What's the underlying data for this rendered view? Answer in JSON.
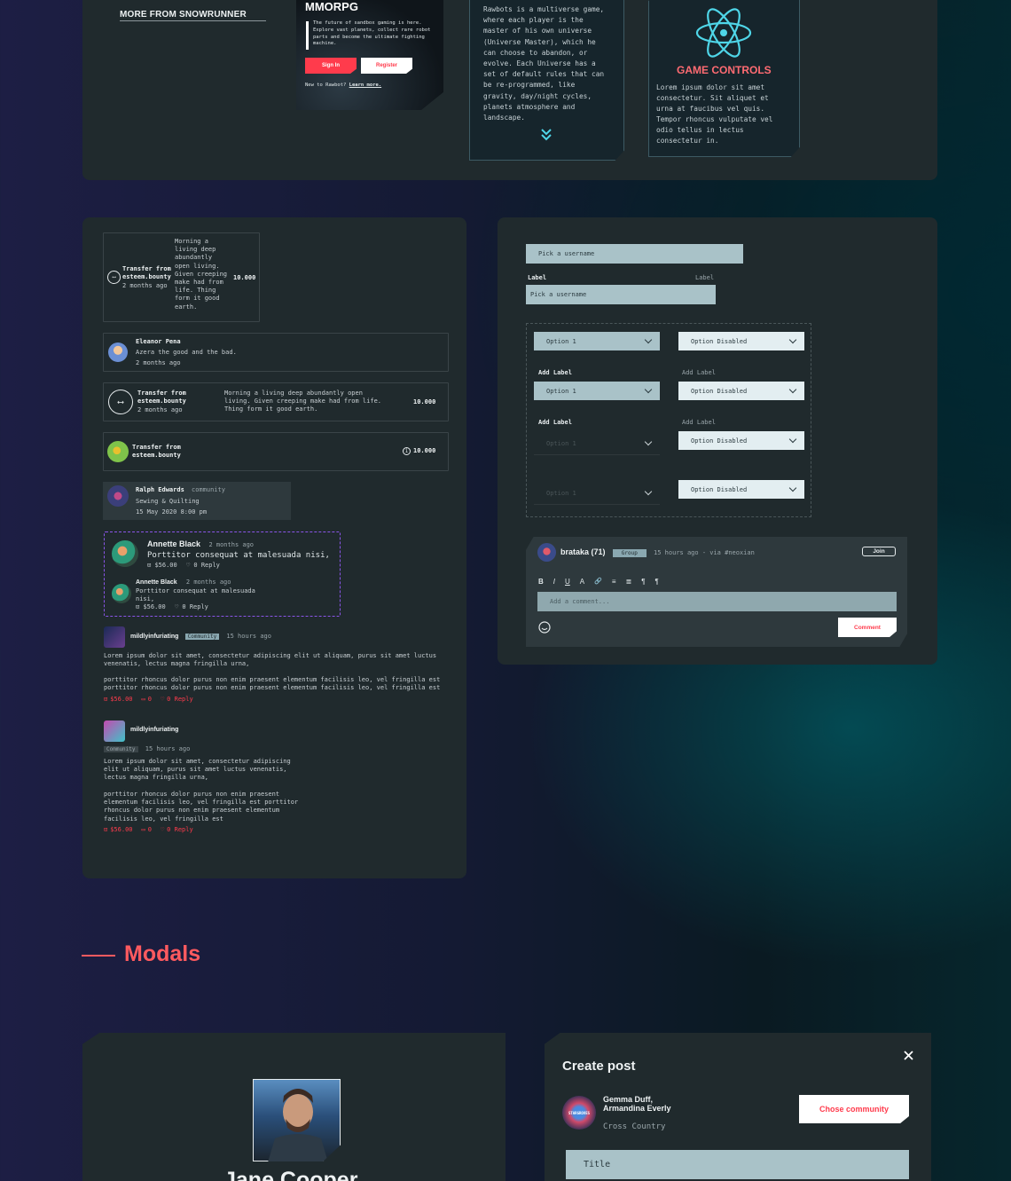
{
  "top": {
    "more_from_title": "MORE FROM SNOWRUNNER",
    "mmorpg": {
      "title": "MMORPG",
      "desc": "The future of sandbox gaming is here. Explore vast planets, collect rare robot parts and become the ultimate fighting machine.",
      "signin": "Sign In",
      "register": "Register",
      "footer_prefix": "New to Rawbot?",
      "footer_link": "Learn more."
    },
    "rawbots_desc": "Rawbots is a multiverse game, where each player is the master of his own universe (Universe Master), which he can choose to abandon, or evolve. Each Universe has a set of default rules that can be re-programmed, like gravity, day/night cycles, planets atmosphere and landscape.",
    "game_controls": {
      "title": "GAME CONTROLS",
      "desc": "Lorem ipsum dolor sit amet consectetur. Sit aliquet et urna at faucibus vel quis. Tempor rhoncus vulputate vel odio tellus in lectus consectetur in."
    }
  },
  "feed": {
    "tx1": {
      "title": "Transfer from",
      "account": "esteem.bounty",
      "time": "2 months ago",
      "message": "Morning a living deep abundantly open living. Given creeping make had from life. Thing form it good earth.",
      "amount": "10.000"
    },
    "notif": {
      "name": "Eleanor Pena",
      "text": "Azera the good and the bad.",
      "time": "2 months ago"
    },
    "tx2": {
      "title": "Transfer from",
      "account": "esteem.bounty",
      "time": "2 months ago",
      "message": "Morning a living deep abundantly open living. Given creeping make had from life. Thing form it good earth.",
      "amount": "10.000"
    },
    "tx3": {
      "title": "Transfer from",
      "account": "esteem.bounty",
      "amount": "10.000"
    },
    "ralph": {
      "name": "Ralph Edwards",
      "tag": "community",
      "sub": "Sewing & Quilting",
      "date": "15 May 2020 8:00 pm"
    },
    "annette1": {
      "name": "Annette Black",
      "time": "2 months ago",
      "text": "Porttitor consequat at malesuada nisi,",
      "amount": "$56.00",
      "reply": "0 Reply"
    },
    "annette2": {
      "name": "Annette Black",
      "time": "2 months ago",
      "text": "Porttitor consequat at malesuada nisi,",
      "amount": "$56.00",
      "reply": "0 Reply"
    },
    "post1": {
      "user": "mildlyinfuriating",
      "badge": "Community",
      "time": "15 hours ago",
      "p1": "Lorem ipsum dolor sit amet, consectetur adipiscing elit ut aliquam, purus sit amet luctus venenatis, lectus magna fringilla urna,",
      "p2": "porttitor rhoncus dolor purus non enim praesent elementum facilisis leo, vel fringilla est porttitor rhoncus dolor purus non enim praesent elementum facilisis leo, vel fringilla est",
      "amount": "$56.00",
      "comments": "0",
      "reply": "0 Reply"
    },
    "post2": {
      "user": "mildlyinfuriating",
      "badge": "Community",
      "time": "15 hours ago",
      "p1": "Lorem ipsum dolor sit amet, consectetur adipiscing elit ut aliquam, purus sit amet luctus venenatis, lectus magna fringilla urna,",
      "p2": "porttitor rhoncus dolor purus non enim praesent elementum facilisis leo, vel fringilla est porttitor rhoncus dolor purus non enim praesent elementum facilisis leo, vel fringilla est",
      "amount": "$56.00",
      "comments": "0",
      "reply": "0 Reply"
    }
  },
  "forms": {
    "username_placeholder": "Pick a username",
    "label_left": "Label",
    "label_right": "Label",
    "username_placeholder2": "Pick a username",
    "option1": "Option 1",
    "option_disabled": "Option Disabled",
    "add_label": "Add Label"
  },
  "comment_box": {
    "user": "brataka (71)",
    "group": "Group",
    "meta": "15 hours ago - via #neoxian",
    "join": "Join",
    "placeholder": "Add a comment...",
    "submit": "Comment",
    "toolbar": [
      "B",
      "I",
      "U",
      "A",
      "🔗",
      "≡",
      "≣",
      "¶",
      "¶"
    ]
  },
  "modals": {
    "section_title": "Modals",
    "profile_name": "Jane Cooper",
    "create_post": {
      "title": "Create post",
      "author": "Gemma Duff, Armandina Everly",
      "location": "Cross Country",
      "choose": "Chose community",
      "title_placeholder": "Title",
      "avatar_text": "STARGROVES"
    }
  },
  "colors": {
    "accent": "#ff3b4c",
    "teal": "#4fd6e8",
    "panel": "#202a2d",
    "field": "#a9c2c8"
  }
}
